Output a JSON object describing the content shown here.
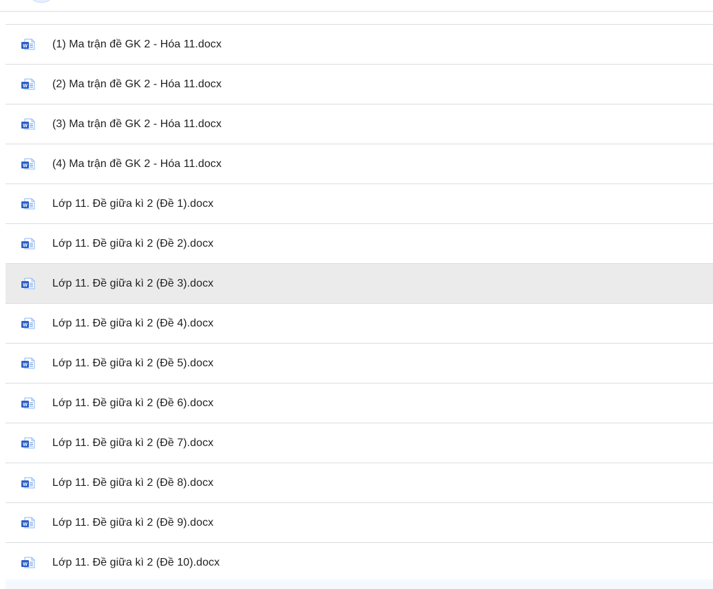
{
  "files": [
    {
      "name": "(1) Ma trận đề GK 2 - Hóa 11.docx",
      "icon": "word-doc-icon",
      "hovered": false
    },
    {
      "name": "(2) Ma trận đề GK 2 - Hóa 11.docx",
      "icon": "word-doc-icon",
      "hovered": false
    },
    {
      "name": "(3) Ma trận đề GK 2 - Hóa 11.docx",
      "icon": "word-doc-icon",
      "hovered": false
    },
    {
      "name": "(4) Ma trận đề GK 2 - Hóa 11.docx",
      "icon": "word-doc-icon",
      "hovered": false
    },
    {
      "name": "Lớp 11. Đề giữa kì 2 (Đề 1).docx",
      "icon": "word-doc-icon",
      "hovered": false
    },
    {
      "name": "Lớp 11. Đề giữa kì 2 (Đề 2).docx",
      "icon": "word-doc-icon",
      "hovered": false
    },
    {
      "name": "Lớp 11. Đề giữa kì 2 (Đề 3).docx",
      "icon": "word-doc-icon",
      "hovered": true
    },
    {
      "name": "Lớp 11. Đề giữa kì 2 (Đề 4).docx",
      "icon": "word-doc-icon",
      "hovered": false
    },
    {
      "name": "Lớp 11. Đề giữa kì 2 (Đề 5).docx",
      "icon": "word-doc-icon",
      "hovered": false
    },
    {
      "name": "Lớp 11. Đề giữa kì 2 (Đề 6).docx",
      "icon": "word-doc-icon",
      "hovered": false
    },
    {
      "name": "Lớp 11. Đề giữa kì 2 (Đề 7).docx",
      "icon": "word-doc-icon",
      "hovered": false
    },
    {
      "name": "Lớp 11. Đề giữa kì 2 (Đề 8).docx",
      "icon": "word-doc-icon",
      "hovered": false
    },
    {
      "name": "Lớp 11. Đề giữa kì 2 (Đề 9).docx",
      "icon": "word-doc-icon",
      "hovered": false
    },
    {
      "name": "Lớp 11. Đề giữa kì 2 (Đề 10).docx",
      "icon": "word-doc-icon",
      "hovered": false
    }
  ],
  "colors": {
    "word_blue": "#2b5fc4",
    "row_hover": "#ebebeb",
    "divider": "#dadce0",
    "text": "#1f1f1f"
  }
}
